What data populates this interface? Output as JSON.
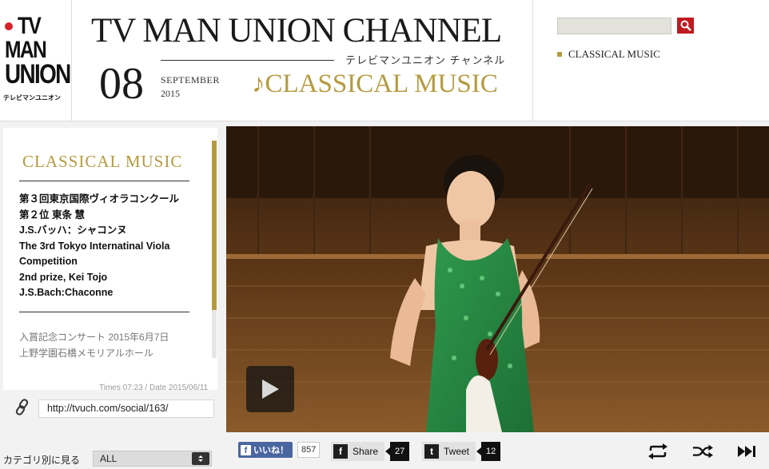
{
  "header": {
    "logo": {
      "line1": "TV",
      "line2": "MAN",
      "line3": "UNION",
      "sub": "テレビマンユニオン"
    },
    "title": "TV MAN UNION CHANNEL",
    "title_jp": "テレビマンユニオン チャンネル",
    "day": "08",
    "month": "SEPTEMBER",
    "year": "2015",
    "category": "♪CLASSICAL MUSIC",
    "nav": [
      "CLASSICAL MUSIC"
    ],
    "accent": "#b59a3e"
  },
  "search": {
    "placeholder": "",
    "icon": "search-icon"
  },
  "program": {
    "category_label": "CLASSICAL MUSIC",
    "description": [
      "第３回東京国際ヴィオラコンクール",
      "第２位 東条 慧",
      "J.S.バッハ：シャコンヌ",
      "The 3rd Tokyo Internatinal Viola",
      "Competition",
      "2nd prize, Kei Tojo",
      "J.S.Bach:Chaconne"
    ],
    "sub_info": [
      "入賞記念コンサート 2015年6月7日",
      "上野学園石橋メモリアルホール"
    ],
    "meta": "Times 07:23 / Date 2015/06/11",
    "url": "http://tvuch.com/social/163/"
  },
  "bottom": {
    "category_view_label": "カテゴリ別に見る",
    "category_select": "ALL",
    "fb_like": "いいね！",
    "fb_count": "857",
    "share_label": "Share",
    "share_count": "27",
    "tweet_label": "Tweet",
    "tweet_count": "12"
  }
}
